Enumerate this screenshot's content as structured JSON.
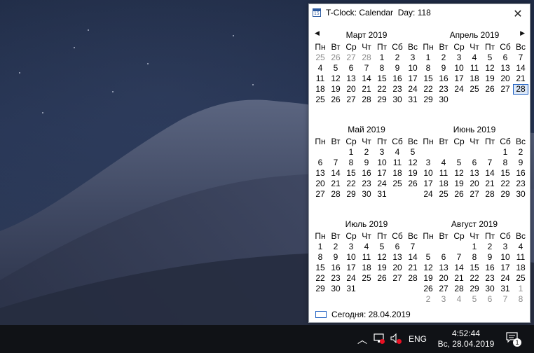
{
  "window": {
    "title": "T-Clock: Calendar  Day: 118",
    "close_symbol": "✕",
    "icon_number": "15"
  },
  "nav": {
    "prev": "◀",
    "next": "▶"
  },
  "weekdays": [
    "Пн",
    "Вт",
    "Ср",
    "Чт",
    "Пт",
    "Сб",
    "Вс"
  ],
  "months": [
    {
      "title": "Март 2019",
      "weeks": [
        [
          {
            "d": "25",
            "o": true
          },
          {
            "d": "26",
            "o": true
          },
          {
            "d": "27",
            "o": true
          },
          {
            "d": "28",
            "o": true
          },
          {
            "d": "1"
          },
          {
            "d": "2"
          },
          {
            "d": "3"
          }
        ],
        [
          {
            "d": "4"
          },
          {
            "d": "5"
          },
          {
            "d": "6"
          },
          {
            "d": "7"
          },
          {
            "d": "8"
          },
          {
            "d": "9"
          },
          {
            "d": "10"
          }
        ],
        [
          {
            "d": "11"
          },
          {
            "d": "12"
          },
          {
            "d": "13"
          },
          {
            "d": "14"
          },
          {
            "d": "15"
          },
          {
            "d": "16"
          },
          {
            "d": "17"
          }
        ],
        [
          {
            "d": "18"
          },
          {
            "d": "19"
          },
          {
            "d": "20"
          },
          {
            "d": "21"
          },
          {
            "d": "22"
          },
          {
            "d": "23"
          },
          {
            "d": "24"
          }
        ],
        [
          {
            "d": "25"
          },
          {
            "d": "26"
          },
          {
            "d": "27"
          },
          {
            "d": "28"
          },
          {
            "d": "29"
          },
          {
            "d": "30"
          },
          {
            "d": "31"
          }
        ]
      ]
    },
    {
      "title": "Апрель 2019",
      "weeks": [
        [
          {
            "d": "1"
          },
          {
            "d": "2"
          },
          {
            "d": "3"
          },
          {
            "d": "4"
          },
          {
            "d": "5"
          },
          {
            "d": "6"
          },
          {
            "d": "7"
          }
        ],
        [
          {
            "d": "8"
          },
          {
            "d": "9"
          },
          {
            "d": "10"
          },
          {
            "d": "11"
          },
          {
            "d": "12"
          },
          {
            "d": "13"
          },
          {
            "d": "14"
          }
        ],
        [
          {
            "d": "15"
          },
          {
            "d": "16"
          },
          {
            "d": "17"
          },
          {
            "d": "18"
          },
          {
            "d": "19"
          },
          {
            "d": "20"
          },
          {
            "d": "21"
          }
        ],
        [
          {
            "d": "22"
          },
          {
            "d": "23"
          },
          {
            "d": "24"
          },
          {
            "d": "25"
          },
          {
            "d": "26"
          },
          {
            "d": "27"
          },
          {
            "d": "28",
            "today": true
          }
        ],
        [
          {
            "d": "29"
          },
          {
            "d": "30"
          },
          {
            "d": ""
          },
          {
            "d": ""
          },
          {
            "d": ""
          },
          {
            "d": ""
          },
          {
            "d": ""
          }
        ]
      ],
      "first_row_blank": true
    },
    {
      "title": "Май 2019",
      "weeks": [
        [
          {
            "d": ""
          },
          {
            "d": ""
          },
          {
            "d": "1"
          },
          {
            "d": "2"
          },
          {
            "d": "3"
          },
          {
            "d": "4"
          },
          {
            "d": "5"
          }
        ],
        [
          {
            "d": "6"
          },
          {
            "d": "7"
          },
          {
            "d": "8"
          },
          {
            "d": "9"
          },
          {
            "d": "10"
          },
          {
            "d": "11"
          },
          {
            "d": "12"
          }
        ],
        [
          {
            "d": "13"
          },
          {
            "d": "14"
          },
          {
            "d": "15"
          },
          {
            "d": "16"
          },
          {
            "d": "17"
          },
          {
            "d": "18"
          },
          {
            "d": "19"
          }
        ],
        [
          {
            "d": "20"
          },
          {
            "d": "21"
          },
          {
            "d": "22"
          },
          {
            "d": "23"
          },
          {
            "d": "24"
          },
          {
            "d": "25"
          },
          {
            "d": "26"
          }
        ],
        [
          {
            "d": "27"
          },
          {
            "d": "28"
          },
          {
            "d": "29"
          },
          {
            "d": "30"
          },
          {
            "d": "31"
          },
          {
            "d": ""
          },
          {
            "d": ""
          }
        ]
      ]
    },
    {
      "title": "Июнь 2019",
      "weeks": [
        [
          {
            "d": ""
          },
          {
            "d": ""
          },
          {
            "d": ""
          },
          {
            "d": ""
          },
          {
            "d": ""
          },
          {
            "d": "1"
          },
          {
            "d": "2"
          }
        ],
        [
          {
            "d": "3"
          },
          {
            "d": "4"
          },
          {
            "d": "5"
          },
          {
            "d": "6"
          },
          {
            "d": "7"
          },
          {
            "d": "8"
          },
          {
            "d": "9"
          }
        ],
        [
          {
            "d": "10"
          },
          {
            "d": "11"
          },
          {
            "d": "12"
          },
          {
            "d": "13"
          },
          {
            "d": "14"
          },
          {
            "d": "15"
          },
          {
            "d": "16"
          }
        ],
        [
          {
            "d": "17"
          },
          {
            "d": "18"
          },
          {
            "d": "19"
          },
          {
            "d": "20"
          },
          {
            "d": "21"
          },
          {
            "d": "22"
          },
          {
            "d": "23"
          }
        ],
        [
          {
            "d": "24"
          },
          {
            "d": "25"
          },
          {
            "d": "26"
          },
          {
            "d": "27"
          },
          {
            "d": "28"
          },
          {
            "d": "29"
          },
          {
            "d": "30"
          }
        ]
      ]
    },
    {
      "title": "Июль 2019",
      "weeks": [
        [
          {
            "d": "1"
          },
          {
            "d": "2"
          },
          {
            "d": "3"
          },
          {
            "d": "4"
          },
          {
            "d": "5"
          },
          {
            "d": "6"
          },
          {
            "d": "7"
          }
        ],
        [
          {
            "d": "8"
          },
          {
            "d": "9"
          },
          {
            "d": "10"
          },
          {
            "d": "11"
          },
          {
            "d": "12"
          },
          {
            "d": "13"
          },
          {
            "d": "14"
          }
        ],
        [
          {
            "d": "15"
          },
          {
            "d": "16"
          },
          {
            "d": "17"
          },
          {
            "d": "18"
          },
          {
            "d": "19"
          },
          {
            "d": "20"
          },
          {
            "d": "21"
          }
        ],
        [
          {
            "d": "22"
          },
          {
            "d": "23"
          },
          {
            "d": "24"
          },
          {
            "d": "25"
          },
          {
            "d": "26"
          },
          {
            "d": "27"
          },
          {
            "d": "28"
          }
        ],
        [
          {
            "d": "29"
          },
          {
            "d": "30"
          },
          {
            "d": "31"
          },
          {
            "d": ""
          },
          {
            "d": ""
          },
          {
            "d": ""
          },
          {
            "d": ""
          }
        ]
      ],
      "first_row_blank": true
    },
    {
      "title": "Август 2019",
      "weeks": [
        [
          {
            "d": ""
          },
          {
            "d": ""
          },
          {
            "d": ""
          },
          {
            "d": "1"
          },
          {
            "d": "2"
          },
          {
            "d": "3"
          },
          {
            "d": "4"
          }
        ],
        [
          {
            "d": "5"
          },
          {
            "d": "6"
          },
          {
            "d": "7"
          },
          {
            "d": "8"
          },
          {
            "d": "9"
          },
          {
            "d": "10"
          },
          {
            "d": "11"
          }
        ],
        [
          {
            "d": "12"
          },
          {
            "d": "13"
          },
          {
            "d": "14"
          },
          {
            "d": "15"
          },
          {
            "d": "16"
          },
          {
            "d": "17"
          },
          {
            "d": "18"
          }
        ],
        [
          {
            "d": "19"
          },
          {
            "d": "20"
          },
          {
            "d": "21"
          },
          {
            "d": "22"
          },
          {
            "d": "23"
          },
          {
            "d": "24"
          },
          {
            "d": "25"
          }
        ],
        [
          {
            "d": "26"
          },
          {
            "d": "27"
          },
          {
            "d": "28"
          },
          {
            "d": "29"
          },
          {
            "d": "30"
          },
          {
            "d": "31"
          },
          {
            "d": "1",
            "o": true
          }
        ],
        [
          {
            "d": "2",
            "o": true
          },
          {
            "d": "3",
            "o": true
          },
          {
            "d": "4",
            "o": true
          },
          {
            "d": "5",
            "o": true
          },
          {
            "d": "6",
            "o": true
          },
          {
            "d": "7",
            "o": true
          },
          {
            "d": "8",
            "o": true
          }
        ]
      ]
    }
  ],
  "today_label": "Сегодня: 28.04.2019",
  "taskbar": {
    "chevron": "︿",
    "language": "ENG",
    "time": "4:52:44",
    "date": "Вс, 28.04.2019",
    "notification_count": "1"
  },
  "colors": {
    "accent": "#1e5fc2",
    "other_month_text": "#8c8c8c",
    "taskbar_bg": "#101216",
    "alert_red": "#e81123"
  },
  "icons": [
    "calendar-app-icon",
    "close-icon",
    "chevron-up-icon",
    "network-icon",
    "volume-muted-icon",
    "notification-icon"
  ]
}
